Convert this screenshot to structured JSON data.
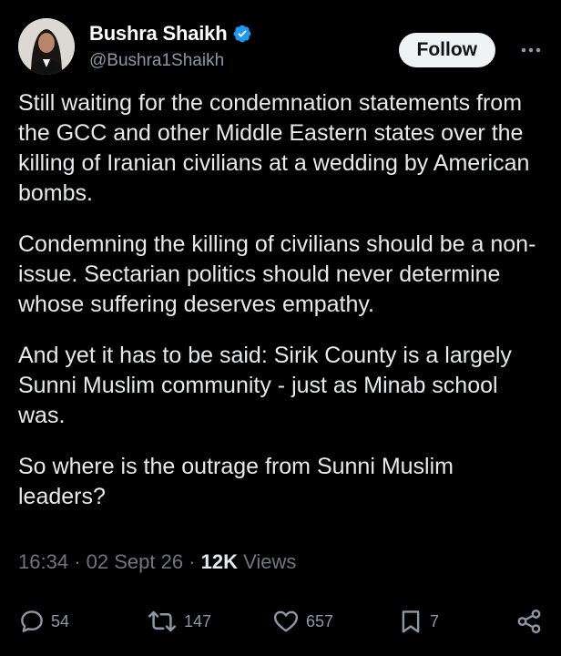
{
  "author": {
    "display_name": "Bushra Shaikh",
    "handle": "@Bushra1Shaikh",
    "verified": true,
    "verified_color": "#1d9bf0"
  },
  "follow_label": "Follow",
  "tweet": {
    "paragraphs": [
      "Still waiting for the condemnation statements from the GCC and other Middle Eastern states over the killing of Iranian civilians at a wedding by American bombs.",
      "Condemning the killing of civilians should be a non-issue. Sectarian politics should never determine whose suffering deserves empathy.",
      "And yet it has to be said: Sirik County is a largely Sunni Muslim community - just as Minab school was.",
      "So where is the outrage from Sunni Muslim leaders?"
    ]
  },
  "meta": {
    "time": "16:34",
    "separator": "·",
    "date": "02 Sept 26",
    "views_count": "12K",
    "views_label": "Views"
  },
  "actions": {
    "replies": "54",
    "reposts": "147",
    "likes": "657",
    "bookmarks": "7"
  },
  "icons": {
    "more": "more-horizontal-icon",
    "reply": "reply-icon",
    "repost": "repost-icon",
    "like": "heart-icon",
    "bookmark": "bookmark-icon",
    "share": "share-icon"
  }
}
